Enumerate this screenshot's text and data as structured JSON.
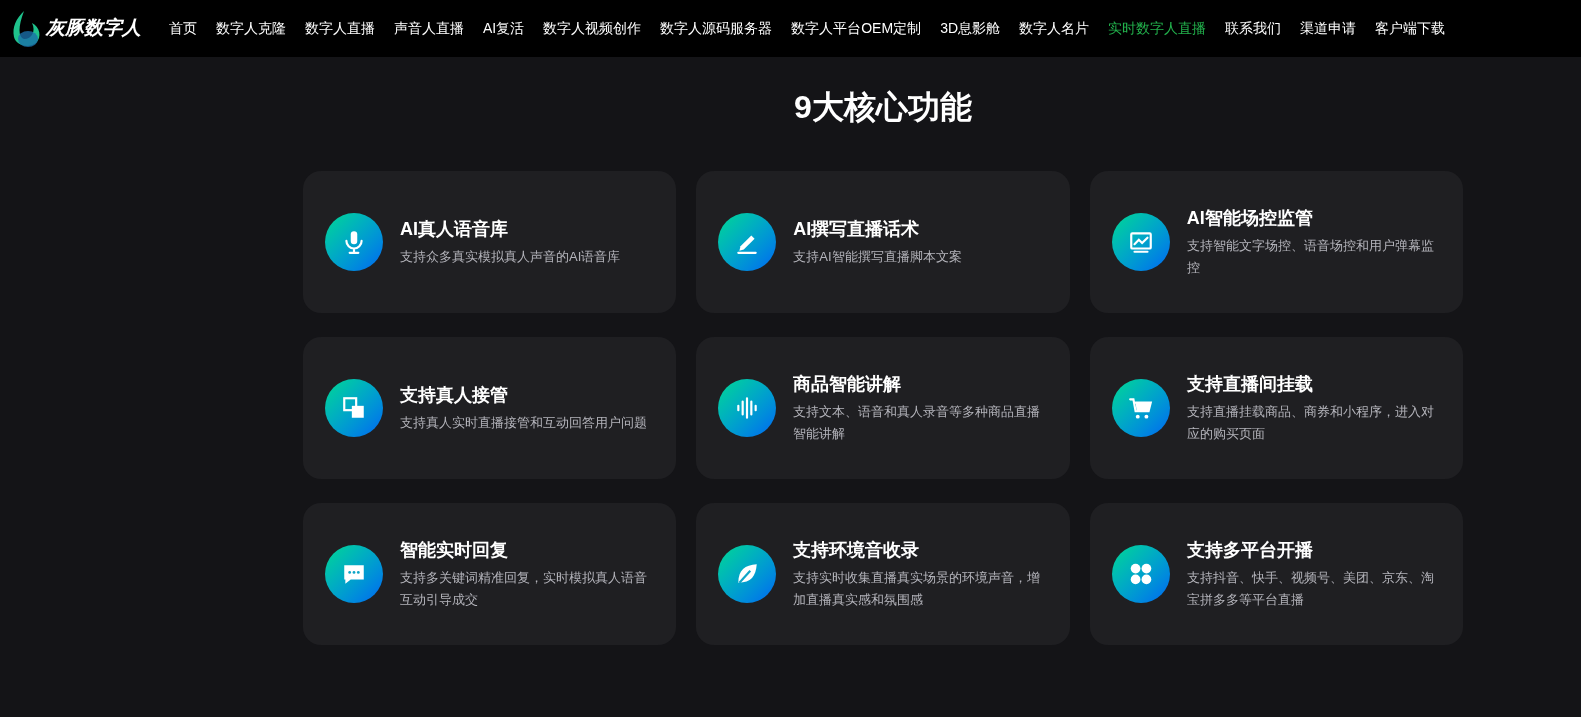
{
  "brand": {
    "name": "灰豚数字人"
  },
  "nav": [
    {
      "label": "首页",
      "selected": false
    },
    {
      "label": "数字人克隆",
      "selected": false
    },
    {
      "label": "数字人直播",
      "selected": false
    },
    {
      "label": "声音人直播",
      "selected": false
    },
    {
      "label": "AI复活",
      "selected": false
    },
    {
      "label": "数字人视频创作",
      "selected": false
    },
    {
      "label": "数字人源码服务器",
      "selected": false
    },
    {
      "label": "数字人平台OEM定制",
      "selected": false
    },
    {
      "label": "3D息影舱",
      "selected": false
    },
    {
      "label": "数字人名片",
      "selected": false
    },
    {
      "label": "实时数字人直播",
      "selected": true
    },
    {
      "label": "联系我们",
      "selected": false
    },
    {
      "label": "渠道申请",
      "selected": false
    },
    {
      "label": "客户端下载",
      "selected": false
    }
  ],
  "section_title": "9大核心功能",
  "features": [
    {
      "title": "AI真人语音库",
      "description": "支持众多真实模拟真人声音的AI语音库"
    },
    {
      "title": "AI撰写直播话术",
      "description": "支持AI智能撰写直播脚本文案"
    },
    {
      "title": "AI智能场控监管",
      "description": "支持智能文字场控、语音场控和用户弹幕监控"
    },
    {
      "title": "支持真人接管",
      "description": "支持真人实时直播接管和互动回答用户问题"
    },
    {
      "title": "商品智能讲解",
      "description": "支持文本、语音和真人录音等多种商品直播智能讲解"
    },
    {
      "title": "支持直播间挂载",
      "description": "支持直播挂载商品、商券和小程序，进入对应的购买页面"
    },
    {
      "title": "智能实时回复",
      "description": "支持多关键词精准回复，实时模拟真人语音互动引导成交"
    },
    {
      "title": "支持环境音收录",
      "description": "支持实时收集直播真实场景的环境声音，增加直播真实感和氛围感"
    },
    {
      "title": "支持多平台开播",
      "description": "支持抖音、快手、视频号、美团、京东、淘宝拼多多等平台直播"
    }
  ]
}
